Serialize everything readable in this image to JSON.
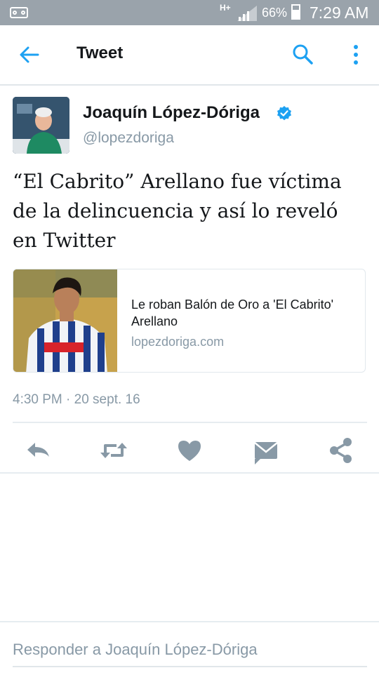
{
  "status_bar": {
    "network_type": "H+",
    "battery_percent": "66%",
    "battery_level": 0.66,
    "time": "7:29 AM"
  },
  "app_bar": {
    "title": "Tweet",
    "back_icon": "arrow-left-icon",
    "search_icon": "search-icon",
    "more_icon": "more-vertical-icon",
    "accent_color": "#1da1f2"
  },
  "tweet": {
    "author_name": "Joaquín López-Dóriga",
    "handle": "@lopezdoriga",
    "verified": true,
    "text": "“El Cabrito” Arellano fue víctima de la delincuencia y así lo reveló en Twitter",
    "timestamp": "4:30 PM · 20 sept. 16"
  },
  "card": {
    "title": "Le roban Balón de Oro a 'El Cabrito' Arellano",
    "domain": "lopezdoriga.com"
  },
  "actions": {
    "reply_icon": "reply-icon",
    "retweet_icon": "retweet-icon",
    "like_icon": "heart-icon",
    "message_icon": "envelope-icon",
    "share_icon": "share-icon",
    "icon_color": "#8899a6"
  },
  "reply": {
    "placeholder": "Responder a Joaquín López-Dóriga"
  }
}
